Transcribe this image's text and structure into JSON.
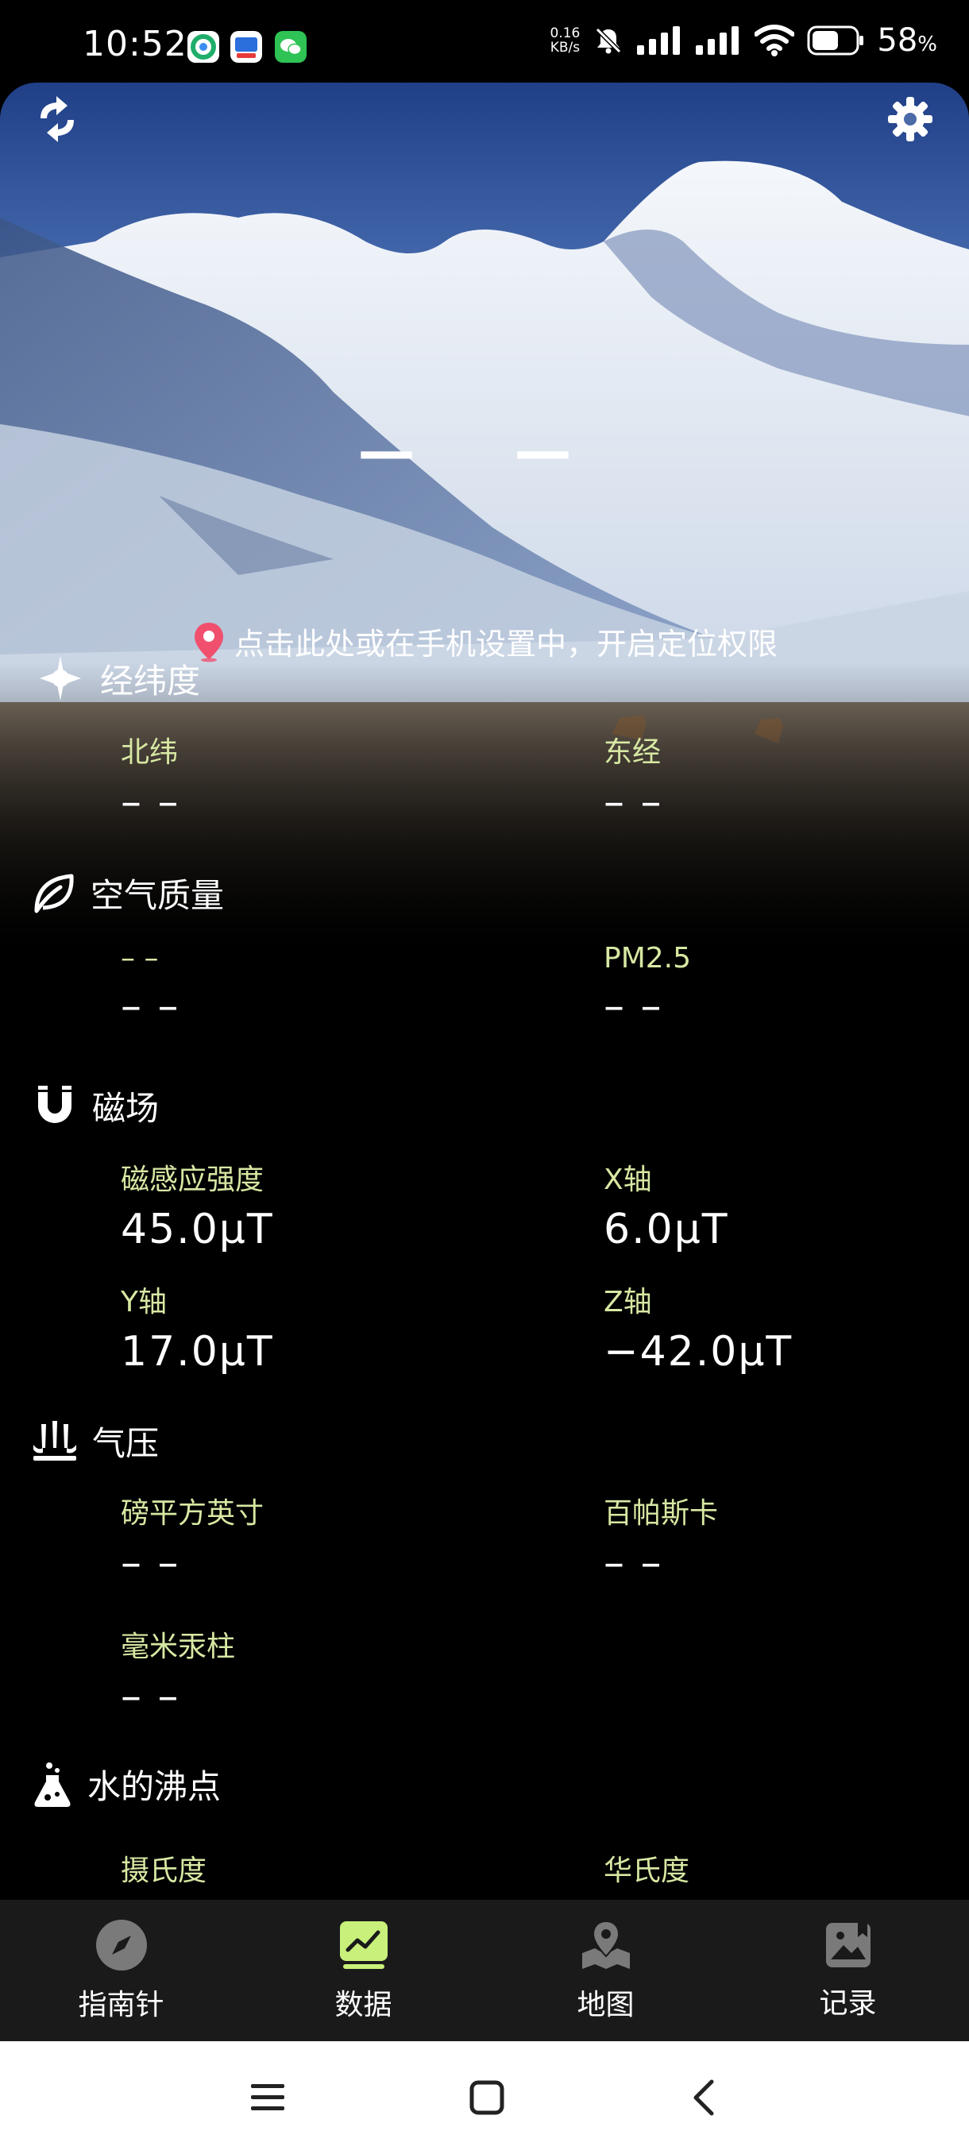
{
  "status_bar": {
    "time": "10:52",
    "net_speed_value": "0.16",
    "net_speed_unit": "KB/s",
    "battery": "58",
    "battery_unit": "%"
  },
  "header": {
    "title": "— —",
    "location_hint": "点击此处或在手机设置中，开启定位权限"
  },
  "sections": {
    "coords": {
      "title": "经纬度",
      "lat_label": "北纬",
      "lat_value": "– –",
      "lon_label": "东经",
      "lon_value": "– –"
    },
    "air": {
      "title": "空气质量",
      "aqi_label": "– –",
      "aqi_value": "– –",
      "pm_label": "PM2.5",
      "pm_value": "– –"
    },
    "magnetic": {
      "title": "磁场",
      "strength_label": "磁感应强度",
      "strength_value": "45.0μT",
      "x_label": "X轴",
      "x_value": "6.0μT",
      "y_label": "Y轴",
      "y_value": "17.0μT",
      "z_label": "Z轴",
      "z_value": "−42.0μT"
    },
    "pressure": {
      "title": "气压",
      "psi_label": "磅平方英寸",
      "psi_value": "– –",
      "hpa_label": "百帕斯卡",
      "hpa_value": "– –",
      "mmhg_label": "毫米汞柱",
      "mmhg_value": "– –"
    },
    "boiling": {
      "title": "水的沸点",
      "c_label": "摄氏度",
      "f_label": "华氏度"
    }
  },
  "nav": {
    "compass": "指南针",
    "data": "数据",
    "map": "地图",
    "record": "记录"
  },
  "colors": {
    "accent": "#d7e8a3",
    "nav_active": "#c8f07a",
    "location_pin": "#f0506e"
  }
}
